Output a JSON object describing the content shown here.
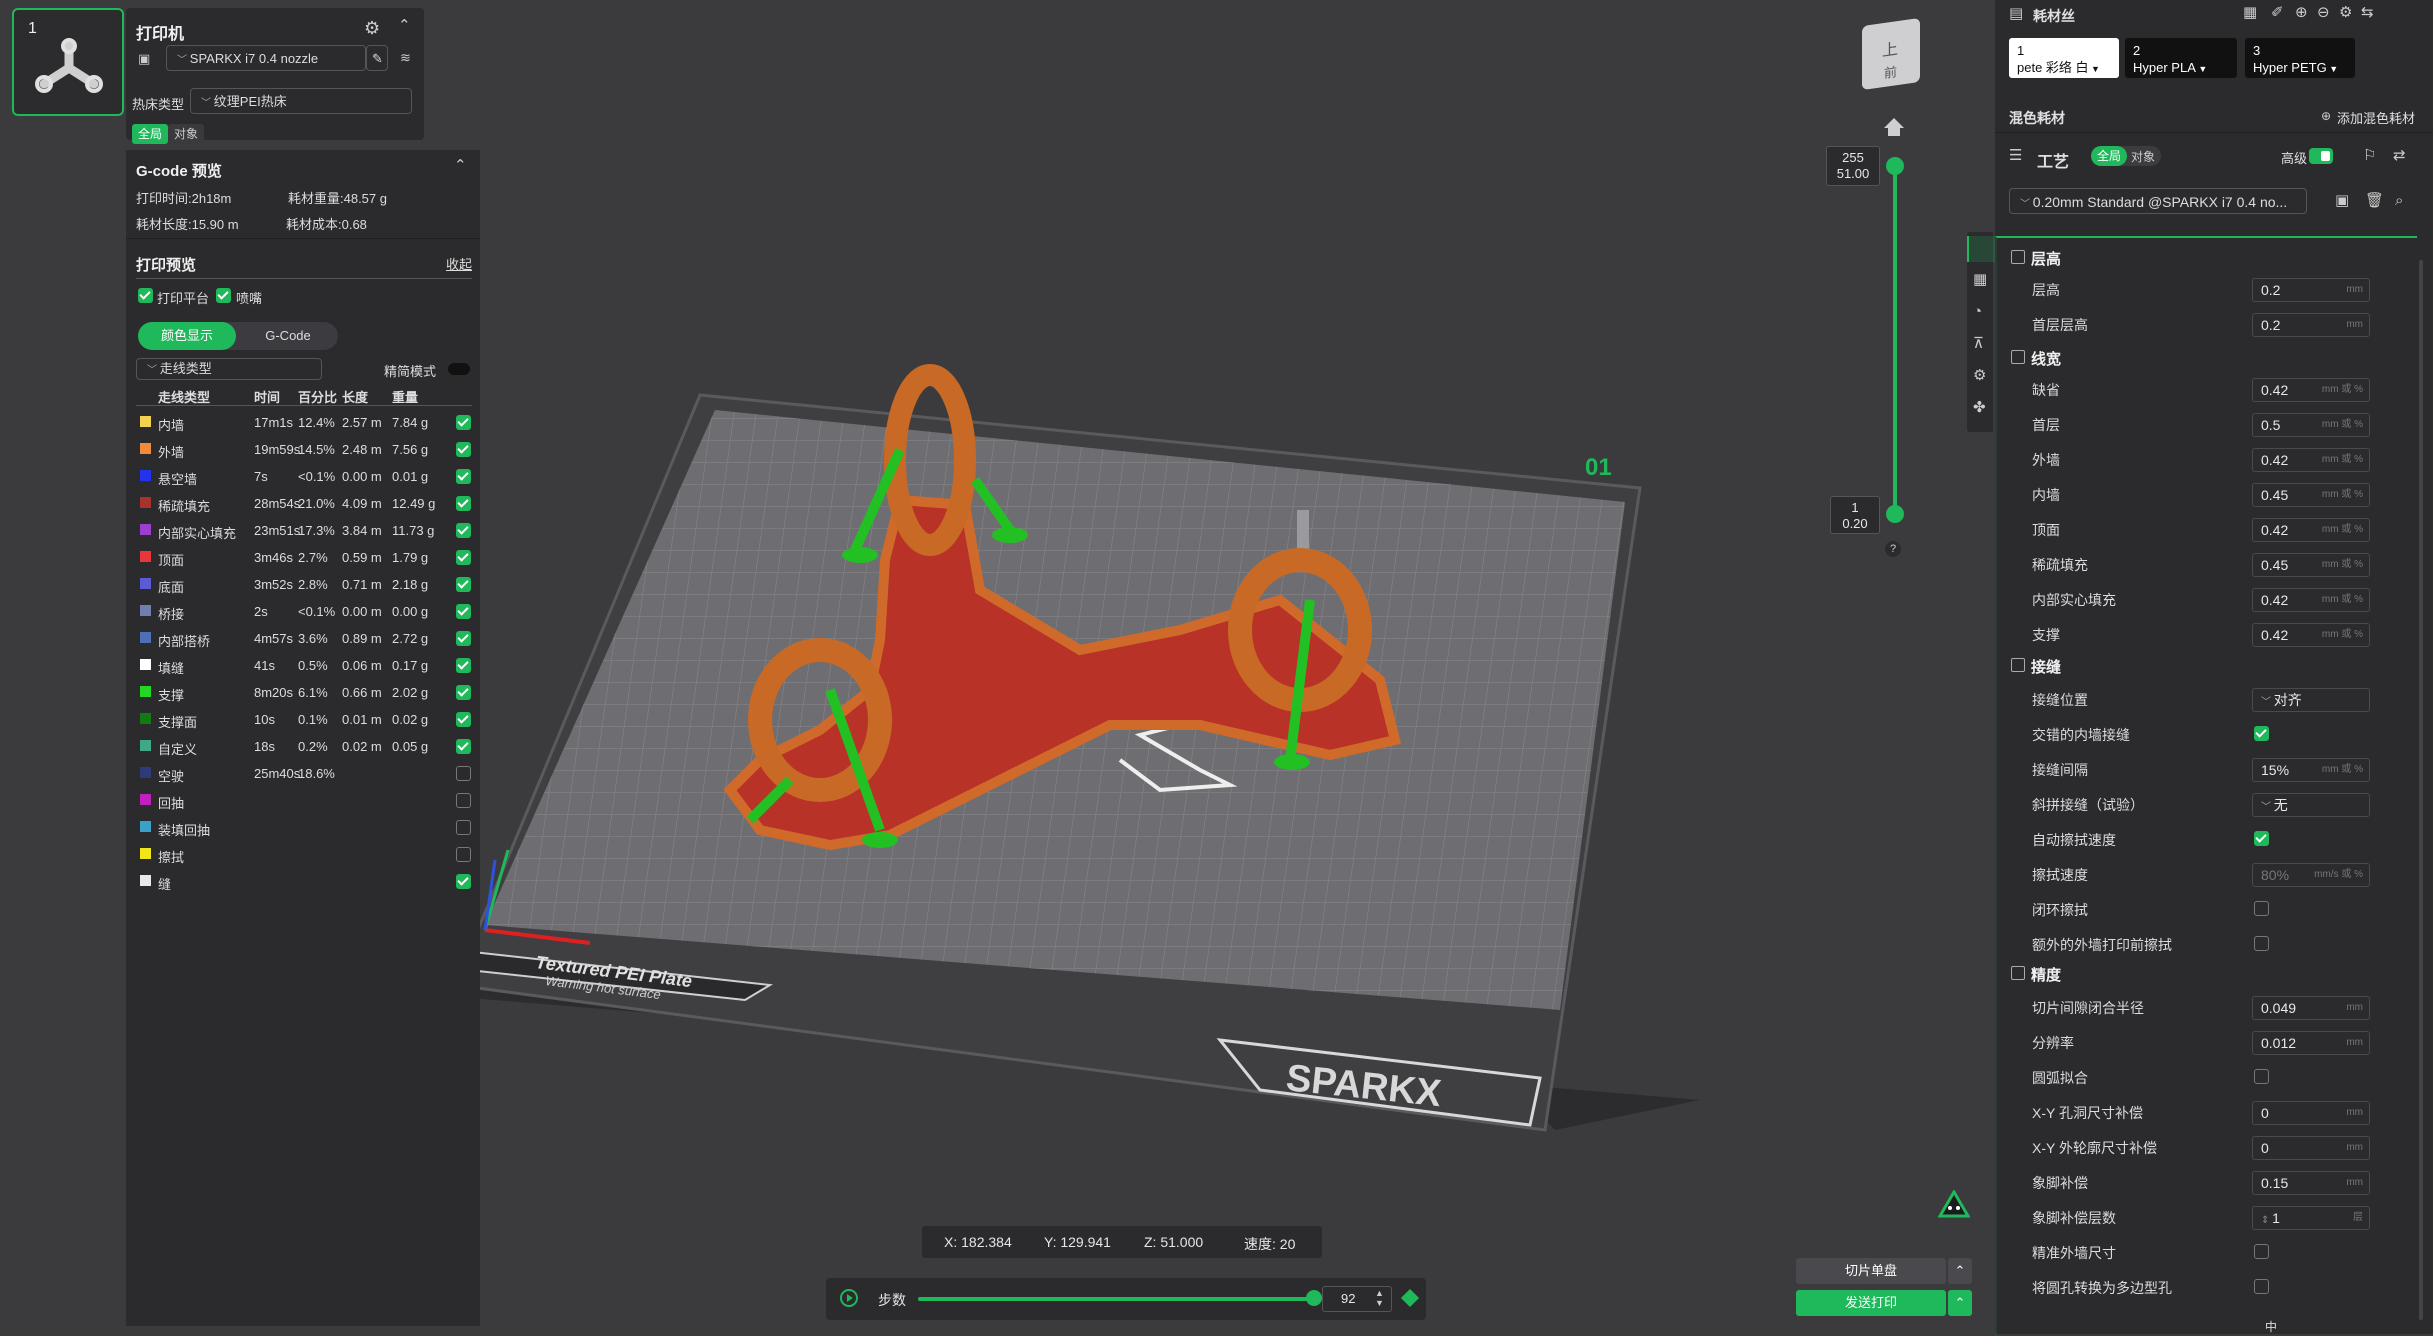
{
  "plate": {
    "number": "1"
  },
  "printer": {
    "title": "打印机",
    "model": "SPARKX i7 0.4 nozzle",
    "bed_type_label": "热床类型",
    "bed_type": "纹理PEI热床",
    "scope_global": "全局",
    "scope_object": "对象"
  },
  "gcode": {
    "title": "G-code 预览",
    "print_time": "打印时间:2h18m",
    "filament_weight": "耗材重量:48.57 g",
    "filament_length": "耗材长度:15.90 m",
    "filament_cost": "耗材成本:0.68"
  },
  "preview": {
    "title": "打印预览",
    "collapse": "收起",
    "show_plate": "打印平台",
    "show_nozzle": "喷嘴",
    "tab_color": "颜色显示",
    "tab_gcode": "G-Code",
    "line_type_select": "走线类型",
    "simple_mode": "精简模式",
    "headers": [
      "走线类型",
      "时间",
      "百分比",
      "长度",
      "重量"
    ],
    "rows": [
      {
        "color": "#f2d24f",
        "name": "内墙",
        "time": "17m1s",
        "pct": "12.4%",
        "len": "2.57 m",
        "wt": "7.84 g",
        "on": true
      },
      {
        "color": "#f28a3c",
        "name": "外墙",
        "time": "19m59s",
        "pct": "14.5%",
        "len": "2.48 m",
        "wt": "7.56 g",
        "on": true
      },
      {
        "color": "#2233ee",
        "name": "悬空墙",
        "time": "7s",
        "pct": "<0.1%",
        "len": "0.00 m",
        "wt": "0.01 g",
        "on": true
      },
      {
        "color": "#a8322c",
        "name": "稀疏填充",
        "time": "28m54s",
        "pct": "21.0%",
        "len": "4.09 m",
        "wt": "12.49 g",
        "on": true
      },
      {
        "color": "#9b3fd0",
        "name": "内部实心填充",
        "time": "23m51s",
        "pct": "17.3%",
        "len": "3.84 m",
        "wt": "11.73 g",
        "on": true
      },
      {
        "color": "#e8363a",
        "name": "顶面",
        "time": "3m46s",
        "pct": "2.7%",
        "len": "0.59 m",
        "wt": "1.79 g",
        "on": true
      },
      {
        "color": "#5b5bd6",
        "name": "底面",
        "time": "3m52s",
        "pct": "2.8%",
        "len": "0.71 m",
        "wt": "2.18 g",
        "on": true
      },
      {
        "color": "#6e7fb0",
        "name": "桥接",
        "time": "2s",
        "pct": "<0.1%",
        "len": "0.00 m",
        "wt": "0.00 g",
        "on": true
      },
      {
        "color": "#4c6fb5",
        "name": "内部搭桥",
        "time": "4m57s",
        "pct": "3.6%",
        "len": "0.89 m",
        "wt": "2.72 g",
        "on": true
      },
      {
        "color": "#ffffff",
        "name": "填缝",
        "time": "41s",
        "pct": "0.5%",
        "len": "0.06 m",
        "wt": "0.17 g",
        "on": true
      },
      {
        "color": "#22d822",
        "name": "支撑",
        "time": "8m20s",
        "pct": "6.1%",
        "len": "0.66 m",
        "wt": "2.02 g",
        "on": true
      },
      {
        "color": "#127a12",
        "name": "支撑面",
        "time": "10s",
        "pct": "0.1%",
        "len": "0.01 m",
        "wt": "0.02 g",
        "on": true
      },
      {
        "color": "#3fa884",
        "name": "自定义",
        "time": "18s",
        "pct": "0.2%",
        "len": "0.02 m",
        "wt": "0.05 g",
        "on": true
      },
      {
        "color": "#2f3a7a",
        "name": "空驶",
        "time": "25m40s",
        "pct": "18.6%",
        "len": "",
        "wt": "",
        "on": false
      },
      {
        "color": "#c21fbf",
        "name": "回抽",
        "time": "",
        "pct": "",
        "len": "",
        "wt": "",
        "on": false
      },
      {
        "color": "#3aa2c8",
        "name": "装填回抽",
        "time": "",
        "pct": "",
        "len": "",
        "wt": "",
        "on": false
      },
      {
        "color": "#f1e61a",
        "name": "擦拭",
        "time": "",
        "pct": "",
        "len": "",
        "wt": "",
        "on": false
      },
      {
        "color": "#e8e8e8",
        "name": "缝",
        "time": "",
        "pct": "",
        "len": "",
        "wt": "",
        "on": true
      }
    ]
  },
  "viewport": {
    "plate_label": "01",
    "bed_text_1": "Textured PEI Plate",
    "bed_text_2": "Warning hot surface",
    "brand": "SPARKX",
    "cube_top": "上",
    "cube_front": "前",
    "layer_top": "255",
    "height_top": "51.00",
    "layer_bottom": "1",
    "height_bottom": "0.20",
    "help": "?",
    "coord_x": "X: 182.384",
    "coord_y": "Y: 129.941",
    "coord_z": "Z: 51.000",
    "speed": "速度: 20",
    "steps_label": "步数",
    "steps_value": "92",
    "slice_button": "切片单盘",
    "send_button": "发送打印"
  },
  "right": {
    "filament_title": "耗材丝",
    "filaments": [
      {
        "num": "1",
        "name": "pete 彩络 白",
        "bg": "#ffffff",
        "fg": "#111111"
      },
      {
        "num": "2",
        "name": "Hyper PLA",
        "bg": "#111111",
        "fg": "#ffffff"
      },
      {
        "num": "3",
        "name": "Hyper PETG",
        "bg": "#111111",
        "fg": "#ffffff"
      }
    ],
    "mix_title": "混色耗材",
    "add_mix": "添加混色耗材",
    "process_title": "工艺",
    "scope_global": "全局",
    "scope_object": "对象",
    "advanced": "高级",
    "preset": "0.20mm Standard @SPARKX i7 0.4 no...",
    "sections": {
      "layer": "层高",
      "width": "线宽",
      "seam": "接缝",
      "precision": "精度"
    },
    "params": {
      "layer_height": {
        "label": "层高",
        "value": "0.2",
        "unit": "mm"
      },
      "first_layer_height": {
        "label": "首层层高",
        "value": "0.2",
        "unit": "mm"
      },
      "w_default": {
        "label": "缺省",
        "value": "0.42",
        "unit": "mm 或 %"
      },
      "w_first": {
        "label": "首层",
        "value": "0.5",
        "unit": "mm 或 %"
      },
      "w_outer": {
        "label": "外墙",
        "value": "0.42",
        "unit": "mm 或 %"
      },
      "w_inner": {
        "label": "内墙",
        "value": "0.45",
        "unit": "mm 或 %"
      },
      "w_top": {
        "label": "顶面",
        "value": "0.42",
        "unit": "mm 或 %"
      },
      "w_sparse": {
        "label": "稀疏填充",
        "value": "0.45",
        "unit": "mm 或 %"
      },
      "w_solid": {
        "label": "内部实心填充",
        "value": "0.42",
        "unit": "mm 或 %"
      },
      "w_support": {
        "label": "支撑",
        "value": "0.42",
        "unit": "mm 或 %"
      },
      "seam_pos": {
        "label": "接缝位置",
        "value": "对齐"
      },
      "staggered": {
        "label": "交错的内墙接缝"
      },
      "seam_gap": {
        "label": "接缝间隔",
        "value": "15%",
        "unit": "mm 或 %"
      },
      "scarf": {
        "label": "斜拼接缝（试验）",
        "value": "无"
      },
      "auto_wipe": {
        "label": "自动擦拭速度"
      },
      "wipe_speed": {
        "label": "擦拭速度",
        "value": "80%",
        "unit": "mm/s 或 %"
      },
      "loop_wipe": {
        "label": "闭环擦拭"
      },
      "extra_wipe": {
        "label": "额外的外墙打印前擦拭"
      },
      "slice_gap": {
        "label": "切片间隙闭合半径",
        "value": "0.049",
        "unit": "mm"
      },
      "resolution": {
        "label": "分辨率",
        "value": "0.012",
        "unit": "mm"
      },
      "arc_fit": {
        "label": "圆弧拟合"
      },
      "xy_hole": {
        "label": "X-Y 孔洞尺寸补偿",
        "value": "0",
        "unit": "mm"
      },
      "xy_contour": {
        "label": "X-Y 外轮廓尺寸补偿",
        "value": "0",
        "unit": "mm"
      },
      "elephant": {
        "label": "象脚补偿",
        "value": "0.15",
        "unit": "mm"
      },
      "elephant_layers": {
        "label": "象脚补偿层数",
        "value": "1",
        "unit": "层"
      },
      "precise_wall": {
        "label": "精准外墙尺寸"
      },
      "poly_hole": {
        "label": "将圆孔转换为多边型孔"
      }
    }
  },
  "taskbar": {
    "ime": "中"
  }
}
